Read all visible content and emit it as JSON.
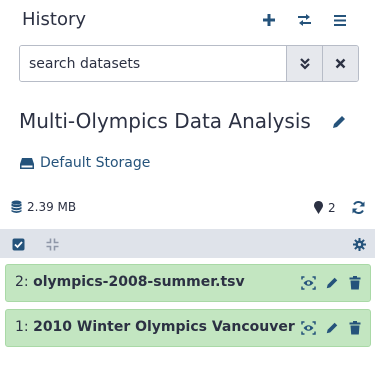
{
  "panel": {
    "title": "History"
  },
  "search": {
    "placeholder": "search datasets",
    "value": ""
  },
  "history": {
    "name": "Multi-Olympics Data Analysis",
    "storage_label": "Default Storage",
    "size": "2.39 MB",
    "count": "2"
  },
  "items": [
    {
      "hid": "2:",
      "name": "olympics-2008-summer.tsv"
    },
    {
      "hid": "1:",
      "name": "2010 Winter Olympics Vancouver"
    }
  ],
  "colors": {
    "text": "#2c3143",
    "link": "#25537b",
    "toolbar_bg": "#dfe3ea",
    "item_ok_bg": "#c3e6c1",
    "item_ok_border": "#a9d9a6"
  }
}
